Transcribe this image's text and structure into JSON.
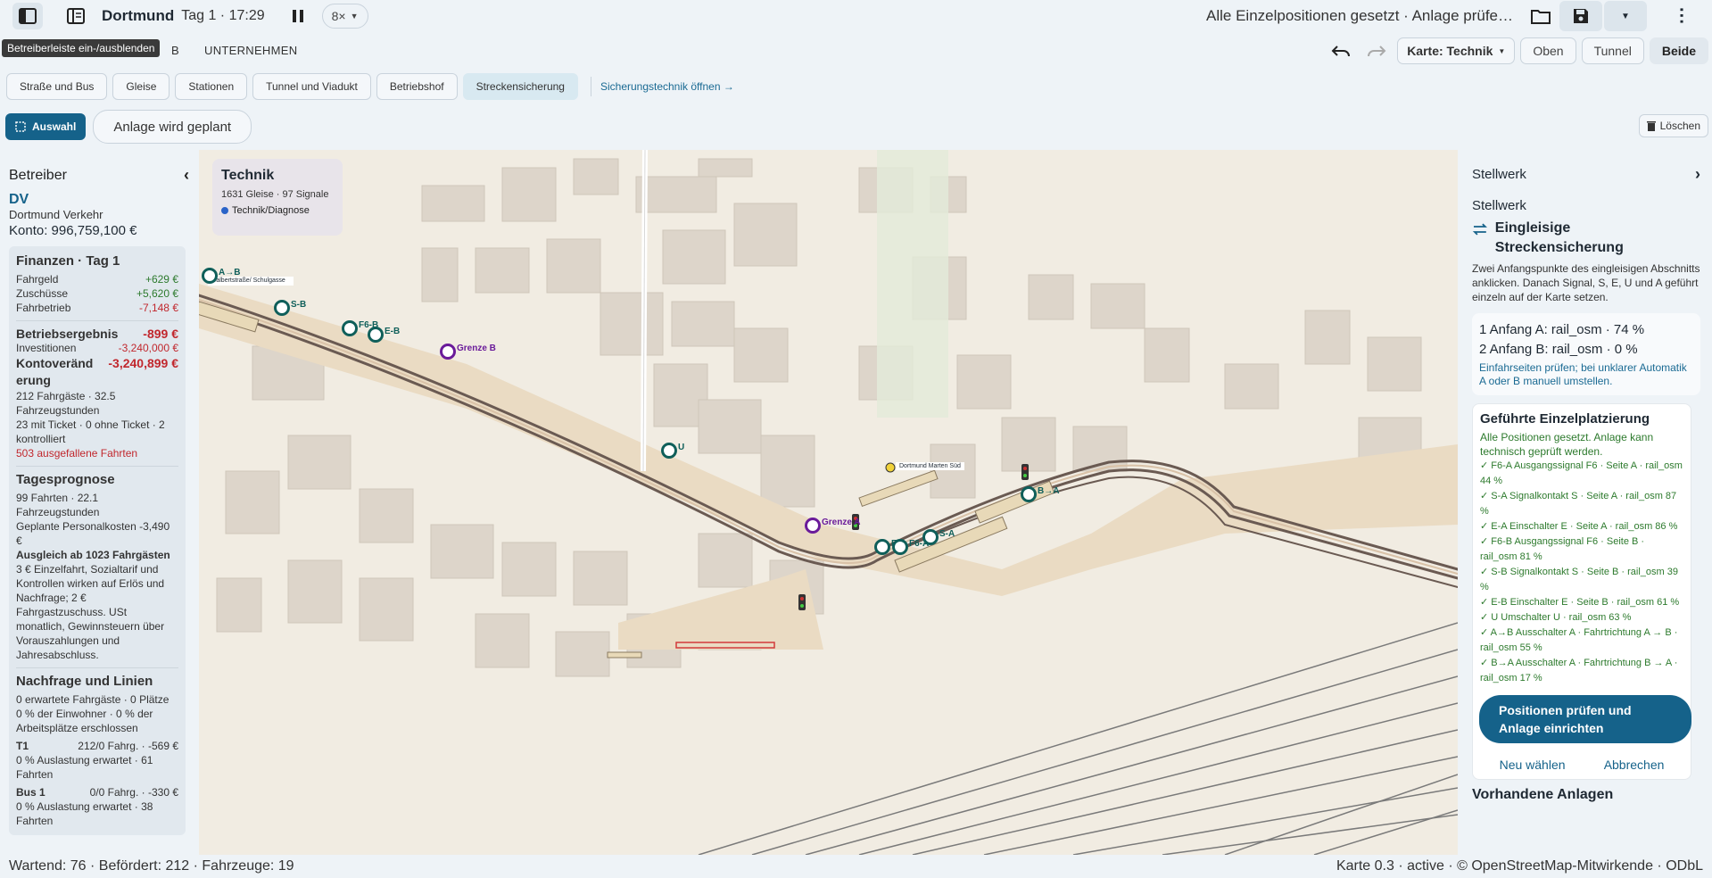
{
  "topbar": {
    "city": "Dortmund",
    "day_time": "Tag 1 · 17:29",
    "speed": "8×",
    "status": "Alle Einzelpositionen gesetzt · Anlage prüfe…",
    "tooltip": "Betreiberleiste ein-/ausblenden"
  },
  "tabs": {
    "partial": "B",
    "unternehmen": "UNTERNEHMEN"
  },
  "right_tools": {
    "karte": "Karte: Technik",
    "oben": "Oben",
    "tunnel": "Tunnel",
    "beide": "Beide"
  },
  "categories": [
    "Straße und Bus",
    "Gleise",
    "Stationen",
    "Tunnel und Viadukt",
    "Betriebshof",
    "Streckensicherung"
  ],
  "category_link": "Sicherungstechnik öffnen →",
  "tools": {
    "auswahl": "Auswahl",
    "plan": "Anlage wird geplant",
    "loeschen": "Löschen"
  },
  "left": {
    "heading": "Betreiber",
    "short": "DV",
    "name": "Dortmund Verkehr",
    "konto": "Konto: 996,759,100 €",
    "fin_title": "Finanzen · Tag 1",
    "fin": [
      {
        "k": "Fahrgeld",
        "v": "+629 €"
      },
      {
        "k": "Zuschüsse",
        "v": "+5,620 €"
      },
      {
        "k": "Fahrbetrieb",
        "v": "-7,148 €"
      }
    ],
    "betrieb_k": "Betriebsergebnis",
    "betrieb_v": "-899 €",
    "invest_k": "Investitionen",
    "invest_v": "-3,240,000 €",
    "konto_k": "Kontoveränd erung",
    "konto_v": "-3,240,899 €",
    "p1": "212 Fahrgäste · 32.5 Fahrzeugstunden",
    "p2": "23 mit Ticket · 0 ohne Ticket · 2 kontrolliert",
    "p3": "503 ausgefallene Fahrten",
    "prog_title": "Tagesprognose",
    "prog1": "99 Fahrten · 22.1 Fahrzeugstunden",
    "prog2": "Geplante Personalkosten -3,490 €",
    "prog3": "Ausgleich ab 1023 Fahrgästen",
    "prog4": "3 € Einzelfahrt, Sozialtarif und Kontrollen wirken auf Erlös und Nachfrage; 2 € Fahrgastzuschuss. USt monatlich, Gewinnsteuern über Vorauszahlungen und Jahresabschluss.",
    "nach_title": "Nachfrage und Linien",
    "nach1": "0 erwartete Fahrgäste · 0 Plätze",
    "nach2": "0 % der Einwohner · 0 % der Arbeitsplätze erschlossen",
    "t1_k": "T1",
    "t1_v": "212/0 Fahrg. · -569 €",
    "t1_d": "0 % Auslastung erwartet · 61 Fahrten",
    "bus_k": "Bus 1",
    "bus_v": "0/0 Fahrg. · -330 €",
    "bus_d": "0 % Auslastung erwartet · 38 Fahrten"
  },
  "map": {
    "card_title": "Technik",
    "card_stats": "1631 Gleise · 97 Signale",
    "card_legend": "Technik/Diagnose",
    "labels": [
      "A→B",
      "S-B",
      "F6-B",
      "E-B",
      "Grenze B",
      "U",
      "Grenze A",
      "E-A",
      "F6-A",
      "S-A",
      "B→A"
    ],
    "stops": [
      "Walbertstraße/ Schulgasse",
      "Dortmund Marten Süd"
    ]
  },
  "right": {
    "heading": "Stellwerk",
    "sub": "Stellwerk",
    "mode_title": "Eingleisige Streckensicherung",
    "desc": "Zwei Anfangspunkte des eingleisigen Abschnitts anklicken. Danach Signal, S, E, U und A geführt einzeln auf der Karte setzen.",
    "anfang_a": "1  Anfang A: rail_osm · 74 %",
    "anfang_b": "2  Anfang B: rail_osm · 0 %",
    "anfang_note": "Einfahrseiten prüfen; bei unklarer Automatik A oder B manuell umstellen.",
    "guide_title": "Geführte Einzelplatzierung",
    "guide_sub": "Alle Positionen gesetzt. Anlage kann technisch geprüft werden.",
    "items": [
      "✓ F6-A  Ausgangssignal F6 · Seite A · rail_osm 44 %",
      "✓ S-A  Signalkontakt S · Seite A · rail_osm 87 %",
      "✓ E-A  Einschalter E · Seite A · rail_osm 86 %",
      "✓ F6-B  Ausgangssignal F6 · Seite B · rail_osm 81 %",
      "✓ S-B  Signalkontakt S · Seite B · rail_osm 39 %",
      "✓ E-B  Einschalter E · Seite B · rail_osm 61 %",
      "✓ U  Umschalter U · rail_osm 63 %",
      "✓ A→B  Ausschalter A · Fahrtrichtung A → B · rail_osm 55 %",
      "✓ B→A  Ausschalter A · Fahrtrichtung B → A · rail_osm 17 %"
    ],
    "check_btn": "Positionen prüfen und Anlage einrichten",
    "neu": "Neu wählen",
    "abbrechen": "Abbrechen",
    "vorhanden": "Vorhandene Anlagen"
  },
  "footer": {
    "left": "Wartend: 76 · Befördert: 212 · Fahrzeuge: 19",
    "right": "Karte 0.3 · active · © OpenStreetMap-Mitwirkende · ODbL"
  },
  "colors": {
    "accent": "#15628a",
    "marker": "#0f5f5a",
    "grenze": "#6a1b9a",
    "positive": "#2d7a2d",
    "negative": "#c1272d"
  }
}
